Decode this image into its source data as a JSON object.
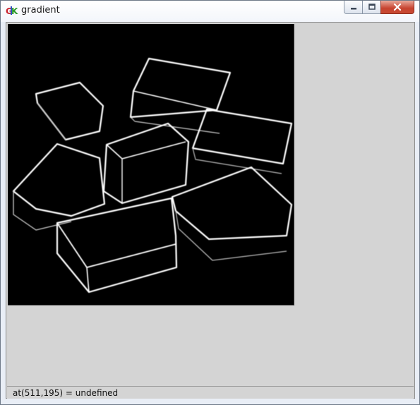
{
  "window": {
    "title": "gradient",
    "app_icon": "gtk-logo-icon"
  },
  "caption_buttons": [
    {
      "name": "minimize",
      "icon": "minimize-icon"
    },
    {
      "name": "maximize",
      "icon": "maximize-icon"
    },
    {
      "name": "close",
      "icon": "close-icon"
    }
  ],
  "image": {
    "content": "edge-detected image of stacked boxes (gradient magnitude)",
    "background": "#000000",
    "edge_color": "#ffffff"
  },
  "status_bar": {
    "text": "at(511,195) = undefined"
  },
  "colors": {
    "client_bg": "#d4d4d4",
    "close_button": "#c7432f"
  }
}
